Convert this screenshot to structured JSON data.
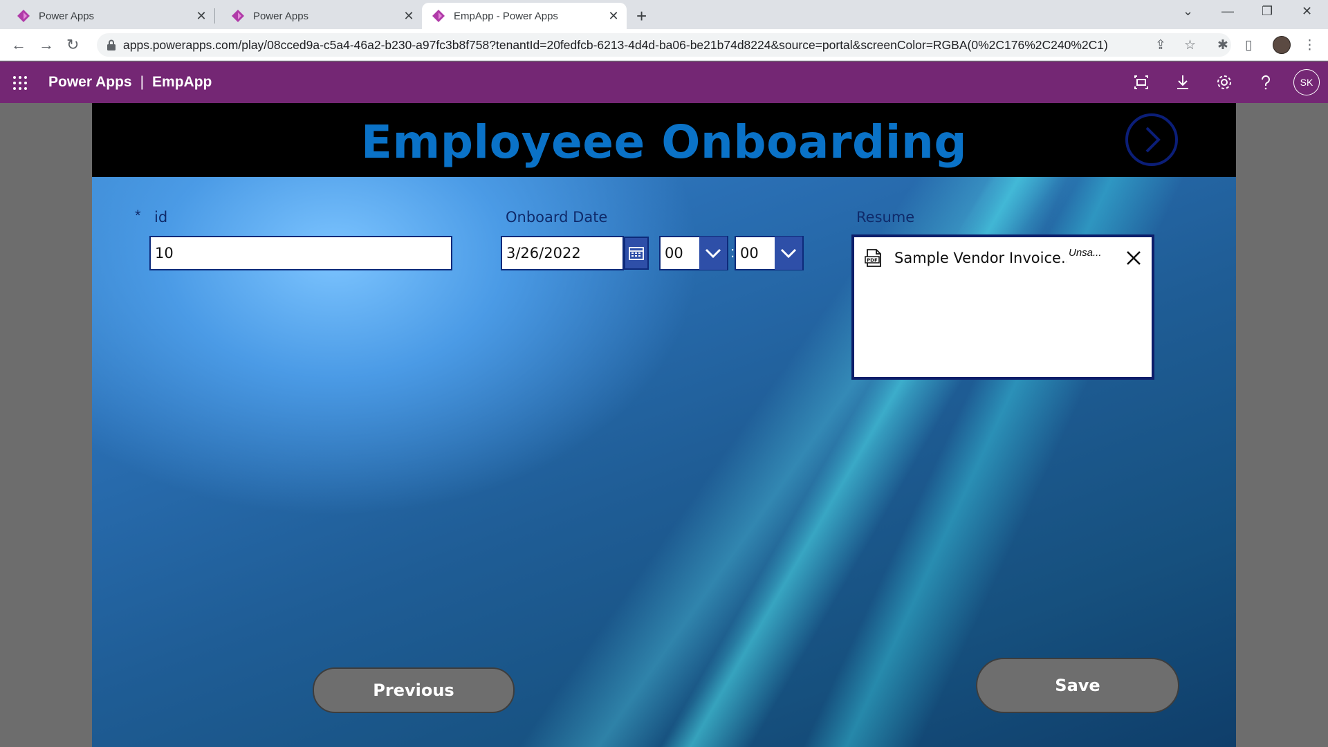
{
  "browser": {
    "tabs": [
      {
        "title": "Power Apps",
        "active": false
      },
      {
        "title": "Power Apps",
        "active": false
      },
      {
        "title": "EmpApp - Power Apps",
        "active": true
      }
    ],
    "url": "apps.powerapps.com/play/08cced9a-c5a4-46a2-b230-a97fc3b8f758?tenantId=20fedfcb-6213-4d4d-ba06-be21b74d8224&source=portal&screenColor=RGBA(0%2C176%2C240%2C1)"
  },
  "header": {
    "product": "Power Apps",
    "separator": "|",
    "app_name": "EmpApp",
    "avatar_initials": "SK"
  },
  "screen": {
    "title": "Employeee Onboarding",
    "id_field": {
      "required_marker": "*",
      "label": "id",
      "value": "10"
    },
    "onboard_date": {
      "label": "Onboard Date",
      "date": "3/26/2022",
      "hour": "00",
      "colon": ":",
      "minute": "00"
    },
    "resume": {
      "label": "Resume",
      "file_name": "Sample Vendor Invoice....",
      "status": "Unsa..."
    },
    "previous_label": "Previous",
    "save_label": "Save"
  },
  "colors": {
    "header_bg": "#742774",
    "title_blue": "#0a72c7",
    "field_border": "#0d2a7a",
    "button_gray": "#6e6e6e"
  }
}
